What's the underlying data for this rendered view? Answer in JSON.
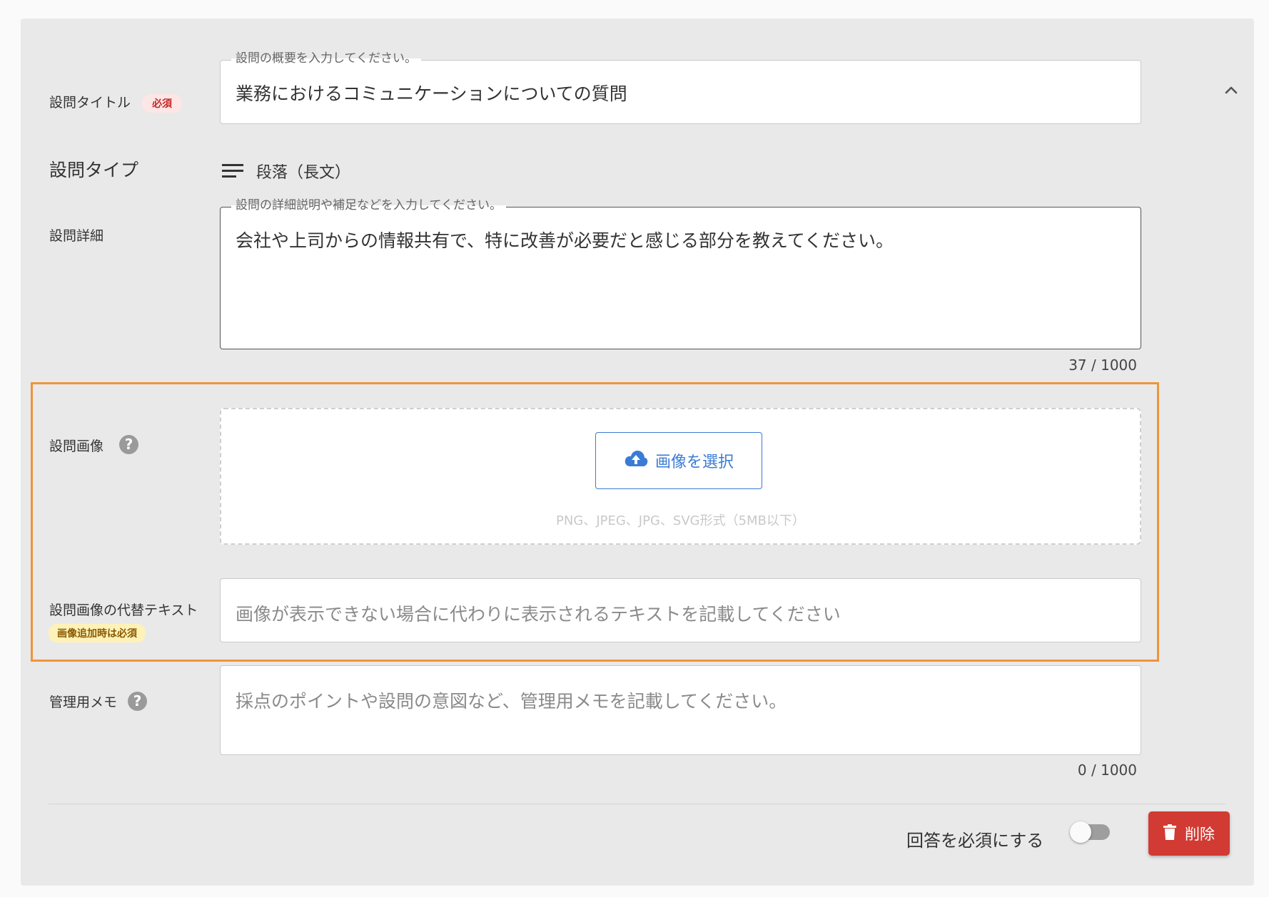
{
  "question": {
    "title_label": "設問タイトル",
    "required_badge": "必須",
    "title_legend": "設問の概要を入力してください。",
    "title_value": "業務におけるコミュニケーションについての質問",
    "type_label": "設問タイプ",
    "type_value": "段落（長文）",
    "detail_label": "設問詳細",
    "detail_legend": "設問の詳細説明や補足などを入力してください。",
    "detail_value": "会社や上司からの情報共有で、特に改善が必要だと感じる部分を教えてください。",
    "detail_counter": "37 / 1000",
    "image_label": "設問画像",
    "image_button": "画像を選択",
    "image_hint": "PNG、JPEG、JPG、SVG形式（5MB以下）",
    "alt_label": "設問画像の代替テキスト",
    "alt_badge": "画像追加時は必須",
    "alt_placeholder": "画像が表示できない場合に代わりに表示されるテキストを記載してください",
    "memo_label": "管理用メモ",
    "memo_placeholder": "採点のポイントや設問の意図など、管理用メモを記載してください。",
    "memo_counter": "0 / 1000",
    "required_toggle_label": "回答を必須にする",
    "required_toggle_on": false,
    "delete_button": "削除",
    "help_glyph": "?"
  },
  "colors": {
    "highlight": "#f0943a",
    "accent": "#3a7bd5",
    "danger": "#d13b33",
    "card": "#e9e9e9"
  },
  "icons": [
    "chevron-up-icon",
    "paragraph-icon",
    "cloud-upload-icon",
    "help-icon",
    "trash-icon"
  ]
}
